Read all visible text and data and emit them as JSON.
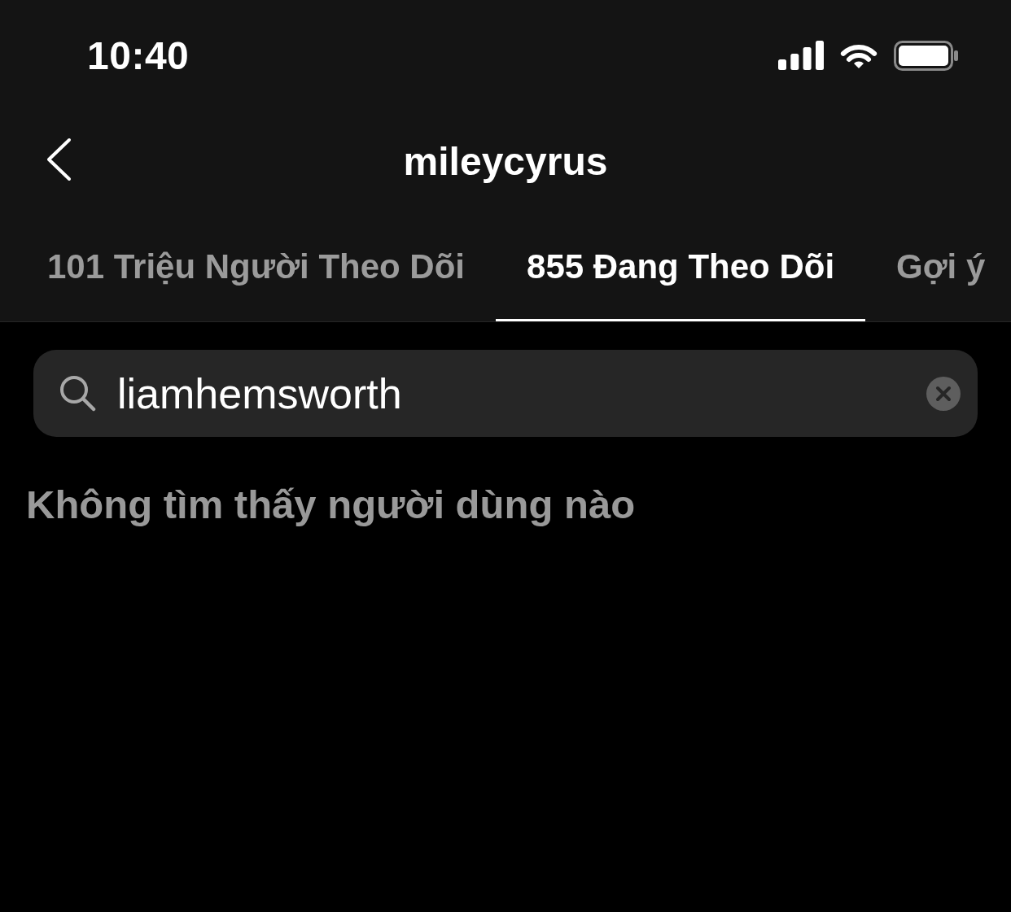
{
  "status_bar": {
    "time": "10:40"
  },
  "header": {
    "title": "mileycyrus"
  },
  "tabs": [
    {
      "label": "101 Triệu Người Theo Dõi",
      "selected": false
    },
    {
      "label": "855 Đang Theo Dõi",
      "selected": true
    },
    {
      "label": "Gợi ý",
      "selected": false
    }
  ],
  "search": {
    "value": "liamhemsworth"
  },
  "empty_message": "Không tìm thấy người dùng nào"
}
